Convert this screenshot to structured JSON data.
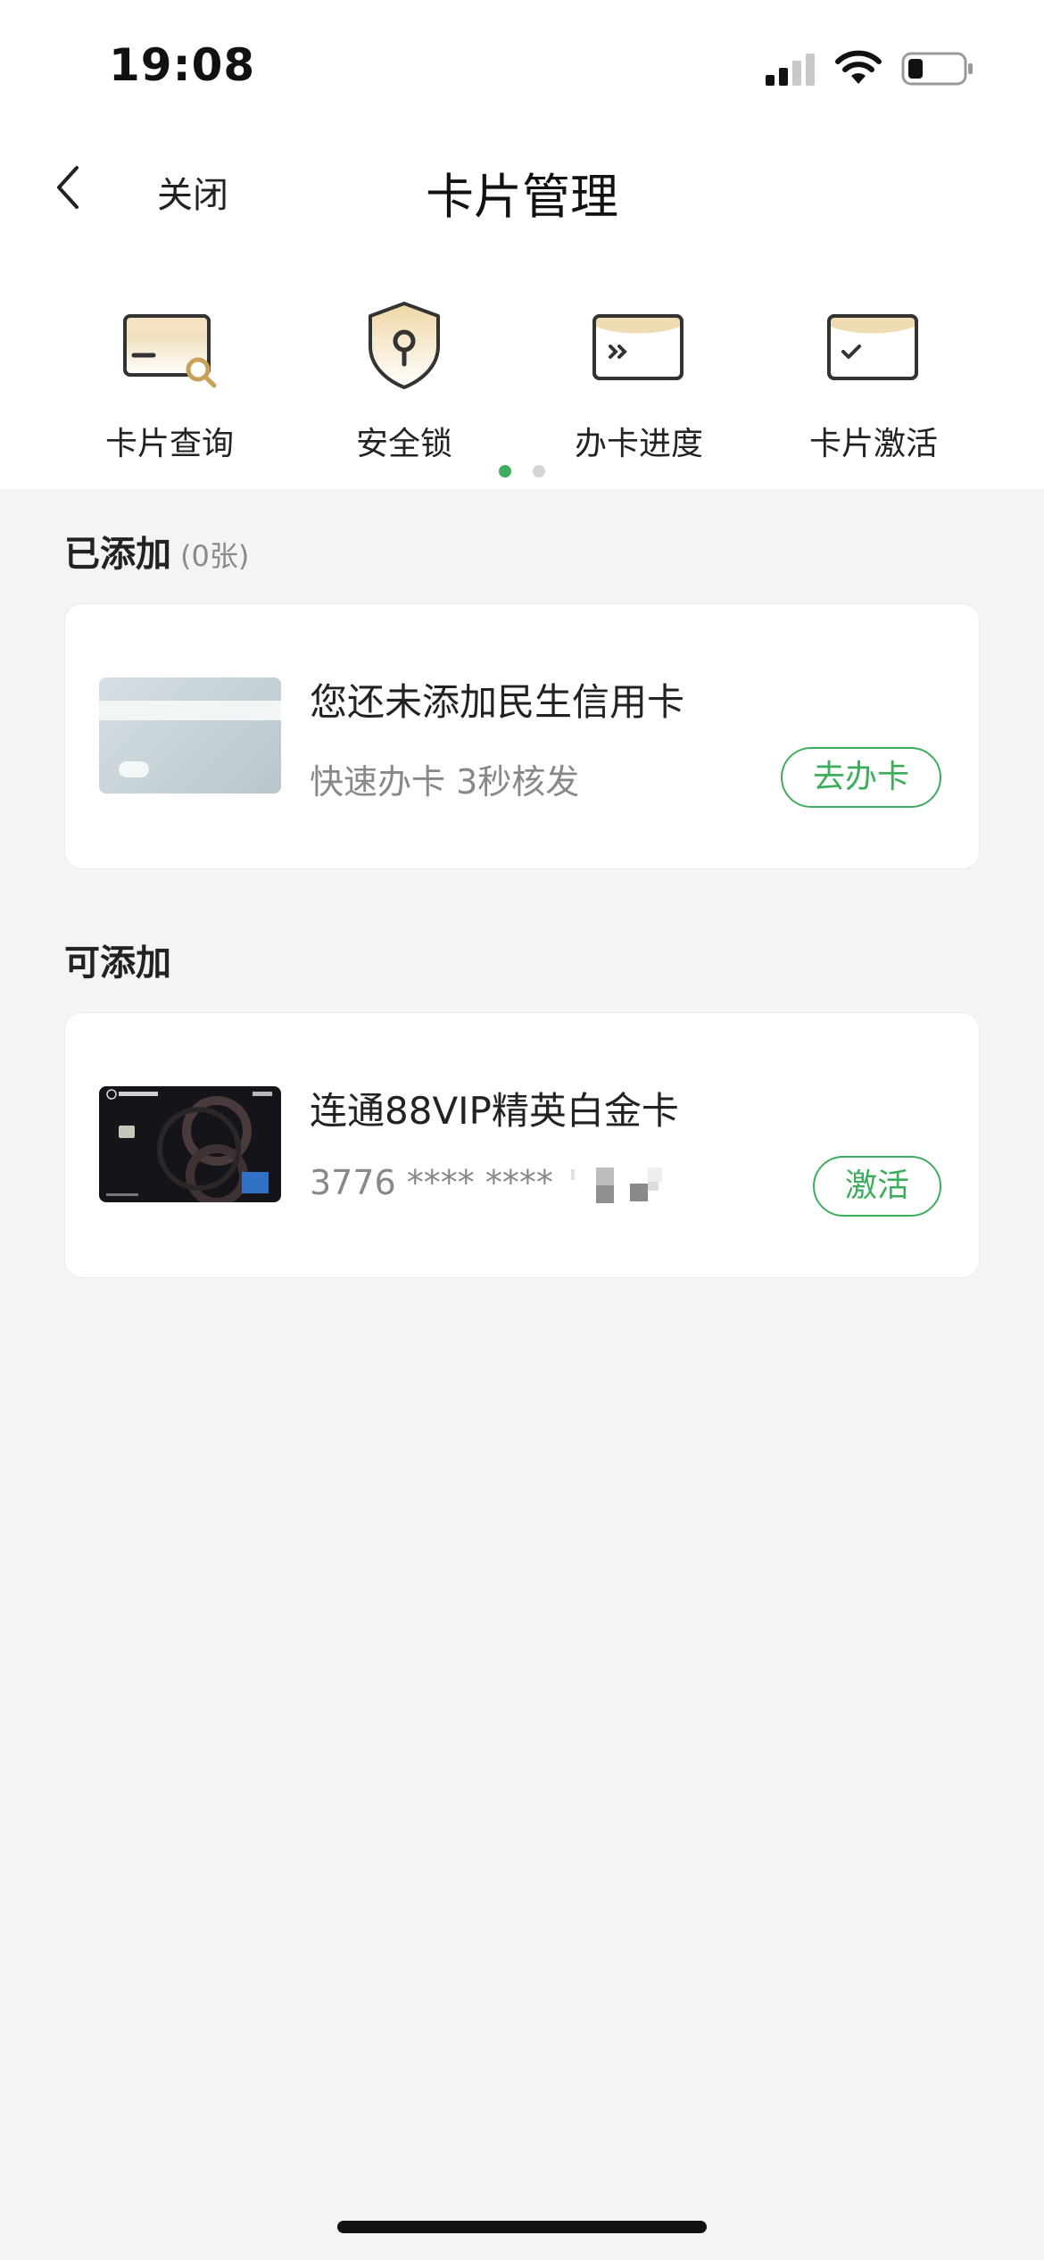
{
  "status_bar": {
    "time": "19:08"
  },
  "nav": {
    "close_label": "关闭",
    "title": "卡片管理"
  },
  "actions": [
    {
      "label": "卡片查询",
      "icon": "card-search-icon"
    },
    {
      "label": "安全锁",
      "icon": "shield-lock-icon"
    },
    {
      "label": "办卡进度",
      "icon": "progress-card-icon"
    },
    {
      "label": "卡片激活",
      "icon": "card-check-icon"
    }
  ],
  "pager": {
    "page_count": 2,
    "active_index": 0
  },
  "added_section": {
    "title": "已添加",
    "count_label": "(0张)"
  },
  "empty_card": {
    "title": "您还未添加民生信用卡",
    "subtitle": "快速办卡 3秒核发",
    "button_label": "去办卡"
  },
  "addable_section": {
    "title": "可添加"
  },
  "addable_card": {
    "name": "连通88VIP精英白金卡",
    "number_visible": "3776 **** ****",
    "button_label": "激活"
  },
  "colors": {
    "accent": "#3cae5b",
    "background": "#f4f4f4",
    "card": "#ffffff"
  }
}
